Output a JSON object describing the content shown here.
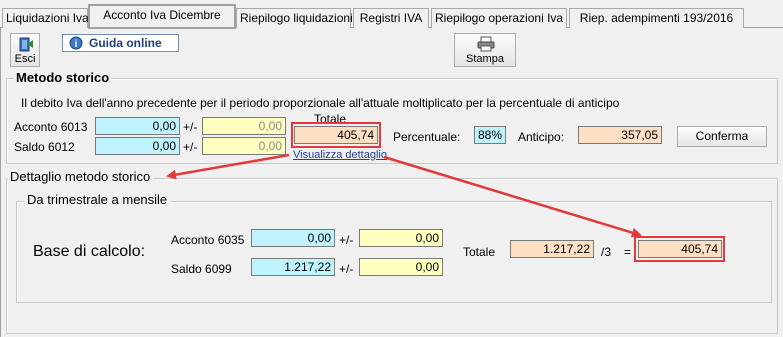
{
  "tabs": [
    {
      "label": "Liquidazioni Iva"
    },
    {
      "label": "Acconto Iva Dicembre"
    },
    {
      "label": "Riepilogo liquidazioni"
    },
    {
      "label": "Registri IVA"
    },
    {
      "label": "Riepilogo operazioni Iva"
    },
    {
      "label": "Riep. adempimenti 193/2016"
    }
  ],
  "toolbar": {
    "esci_label": "Esci",
    "guida_label": "Guida online",
    "stampa_label": "Stampa"
  },
  "metodo_storico": {
    "title": "Metodo storico",
    "description": "Il debito Iva dell'anno precedente per il periodo proporzionale all'attuale moltiplicato per la percentuale di anticipo",
    "acconto_label": "Acconto 6013",
    "acconto_value": "0,00",
    "acconto_adj": "0,00",
    "saldo_label": "Saldo 6012",
    "saldo_value": "0,00",
    "saldo_adj": "0,00",
    "plusminus": "+/-",
    "totale_label": "Totale",
    "totale_value": "405,74",
    "percentuale_label": "Percentuale:",
    "percentuale_value": "88%",
    "anticipo_label": "Anticipo:",
    "anticipo_value": "357,05",
    "conferma_label": "Conferma",
    "visualizza_link": "Visualizza dettaglio"
  },
  "dettaglio": {
    "title": "Dettaglio metodo storico",
    "subgroup_title": "Da trimestrale a mensile",
    "base_label": "Base di calcolo:",
    "acconto_label": "Acconto 6035",
    "acconto_value": "0,00",
    "acconto_adj": "0,00",
    "saldo_label": "Saldo 6099",
    "saldo_value": "1.217,22",
    "saldo_adj": "0,00",
    "plusminus": "+/-",
    "totale_label": "Totale",
    "totale_value": "1.217,22",
    "divisor": "/3",
    "equals": "=",
    "result_value": "405,74"
  },
  "colors": {
    "highlight": "#e03a3a",
    "cyan_field": "#bff3ff",
    "yellow_field": "#ffffc0",
    "peach_field": "#fde0c4"
  },
  "icons": [
    "exit-door-icon",
    "help-globe-icon",
    "printer-icon"
  ]
}
